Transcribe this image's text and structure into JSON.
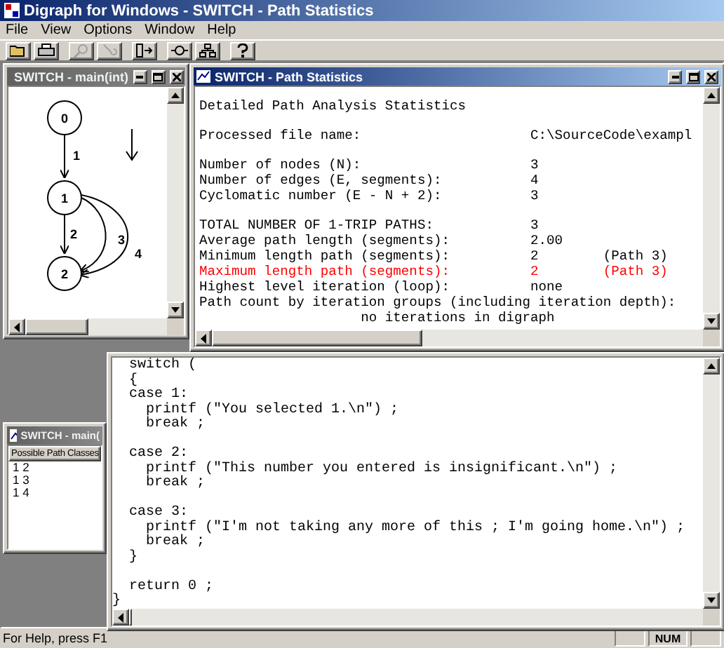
{
  "window": {
    "title": "Digraph for Windows - SWITCH - Path Statistics"
  },
  "menu": [
    "File",
    "View",
    "Options",
    "Window",
    "Help"
  ],
  "toolbar": [
    {
      "kind": "open",
      "disabled": false
    },
    {
      "kind": "print",
      "disabled": false
    },
    {
      "kind": "find",
      "disabled": true
    },
    {
      "kind": "trace",
      "disabled": true
    },
    {
      "kind": "split",
      "disabled": false
    },
    {
      "kind": "node",
      "disabled": false
    },
    {
      "kind": "tree",
      "disabled": false
    },
    {
      "kind": "help",
      "disabled": false
    }
  ],
  "graph_window": {
    "title": "SWITCH - main(int)",
    "active": false,
    "nodes": [
      "0",
      "1",
      "2"
    ],
    "edges": [
      {
        "label": "1"
      },
      {
        "label": "2"
      },
      {
        "label": "3"
      },
      {
        "label": "4"
      }
    ]
  },
  "paths_window": {
    "title": "SWITCH - main(",
    "active": false,
    "header": "Possible Path Classes",
    "items": [
      "1 2",
      "1 3",
      "1 4"
    ]
  },
  "stats_window": {
    "title": "SWITCH - Path Statistics",
    "active": true,
    "heading": "Detailed Path Analysis Statistics",
    "sections": [
      [
        {
          "kind": "pair",
          "label": "Processed file name:",
          "value": "C:\\SourceCode\\exampl",
          "highlight": false
        }
      ],
      [
        {
          "kind": "pair",
          "label": "Number of nodes (N):",
          "value": "3",
          "highlight": false
        },
        {
          "kind": "pair",
          "label": "Number of edges (E, segments):",
          "value": "4",
          "highlight": false
        },
        {
          "kind": "pair",
          "label": "Cyclomatic number (E - N + 2):",
          "value": "3",
          "highlight": false
        }
      ],
      [
        {
          "kind": "pair",
          "label": "TOTAL NUMBER OF 1-TRIP PATHS:",
          "value": "3",
          "highlight": false
        },
        {
          "kind": "pair",
          "label": "Average path length (segments):",
          "value": "2.00",
          "highlight": false
        },
        {
          "kind": "pair",
          "label": "Minimum length path (segments):",
          "value": "2",
          "note": "(Path 3)",
          "highlight": false
        },
        {
          "kind": "pair",
          "label": "Maximum length path (segments):",
          "value": "2",
          "note": "(Path 3)",
          "highlight": true
        },
        {
          "kind": "pair",
          "label": "Highest level iteration (loop):",
          "value": "none",
          "highlight": false
        },
        {
          "kind": "line",
          "text": "Path count by iteration groups (including iteration depth):",
          "highlight": false
        },
        {
          "kind": "indented",
          "text": "no iterations in digraph",
          "highlight": false
        }
      ]
    ]
  },
  "code_window": {
    "blocks": [
      [
        {
          "kind": "top",
          "text": "switch ("
        },
        {
          "kind": "top",
          "text": "{"
        },
        {
          "kind": "top",
          "text": "case 1:"
        },
        {
          "kind": "stmt",
          "text": "printf (\"You selected 1.\\n\") ;"
        },
        {
          "kind": "stmt",
          "text": "break ;"
        }
      ],
      [
        {
          "kind": "top",
          "text": "case 2:"
        },
        {
          "kind": "stmt",
          "text": "printf (\"This number you entered is insignificant.\\n\") ;"
        },
        {
          "kind": "stmt",
          "text": "break ;"
        }
      ],
      [
        {
          "kind": "top",
          "text": "case 3:"
        },
        {
          "kind": "stmt",
          "text": "printf (\"I'm not taking any more of this ; I'm going home.\\n\") ;"
        },
        {
          "kind": "stmt",
          "text": "break ;"
        },
        {
          "kind": "top",
          "text": "}"
        }
      ],
      [
        {
          "kind": "top",
          "text": "return 0 ;"
        },
        {
          "kind": "outer",
          "text": "}"
        }
      ]
    ]
  },
  "status_bar": {
    "message": "For Help, press F1",
    "indicator": "NUM"
  }
}
